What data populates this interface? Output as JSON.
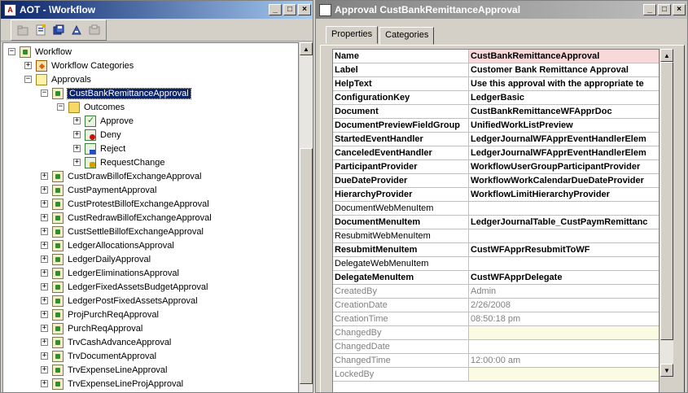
{
  "left_window": {
    "title": "AOT - \\Workflow",
    "tree": {
      "root": "Workflow",
      "categories": "Workflow Categories",
      "approvals": "Approvals",
      "selected": "CustBankRemittanceApproval",
      "outcomes": "Outcomes",
      "outcome_items": [
        "Approve",
        "Deny",
        "Reject",
        "RequestChange"
      ],
      "items": [
        "CustDrawBillofExchangeApproval",
        "CustPaymentApproval",
        "CustProtestBillofExchangeApproval",
        "CustRedrawBillofExchangeApproval",
        "CustSettleBillofExchangeApproval",
        "LedgerAllocationsApproval",
        "LedgerDailyApproval",
        "LedgerEliminationsApproval",
        "LedgerFixedAssetsBudgetApproval",
        "LedgerPostFixedAssetsApproval",
        "ProjPurchReqApproval",
        "PurchReqApproval",
        "TrvCashAdvanceApproval",
        "TrvDocumentApproval",
        "TrvExpenseLineApproval",
        "TrvExpenseLineProjApproval"
      ]
    }
  },
  "right_window": {
    "title": "Approval CustBankRemittanceApproval",
    "tabs": [
      "Properties",
      "Categories"
    ],
    "properties": [
      {
        "name": "Name",
        "value": "CustBankRemittanceApproval",
        "style": "bold",
        "highlight": "pink"
      },
      {
        "name": "Label",
        "value": "Customer Bank Remittance Approval",
        "style": "bold"
      },
      {
        "name": "HelpText",
        "value": "Use this approval with the appropriate te",
        "style": "bold"
      },
      {
        "name": "ConfigurationKey",
        "value": "LedgerBasic",
        "style": "bold"
      },
      {
        "name": "Document",
        "value": "CustBankRemittanceWFApprDoc",
        "style": "bold"
      },
      {
        "name": "DocumentPreviewFieldGroup",
        "value": "UnifiedWorkListPreview",
        "style": "bold"
      },
      {
        "name": "StartedEventHandler",
        "value": "LedgerJournalWFApprEventHandlerElem",
        "style": "bold"
      },
      {
        "name": "CanceledEventHandler",
        "value": "LedgerJournalWFApprEventHandlerElem",
        "style": "bold"
      },
      {
        "name": "ParticipantProvider",
        "value": "WorkflowUserGroupParticipantProvider",
        "style": "bold"
      },
      {
        "name": "DueDateProvider",
        "value": "WorkflowWorkCalendarDueDateProvider",
        "style": "bold"
      },
      {
        "name": "HierarchyProvider",
        "value": "WorkflowLimitHierarchyProvider",
        "style": "bold"
      },
      {
        "name": "DocumentWebMenuItem",
        "value": "",
        "style": "normal"
      },
      {
        "name": "DocumentMenuItem",
        "value": "LedgerJournalTable_CustPaymRemittanc",
        "style": "bold"
      },
      {
        "name": "ResubmitWebMenuItem",
        "value": "",
        "style": "normal"
      },
      {
        "name": "ResubmitMenuItem",
        "value": "CustWFApprResubmitToWF",
        "style": "bold"
      },
      {
        "name": "DelegateWebMenuItem",
        "value": "",
        "style": "normal"
      },
      {
        "name": "DelegateMenuItem",
        "value": "CustWFApprDelegate",
        "style": "bold"
      },
      {
        "name": "CreatedBy",
        "value": "Admin",
        "style": "readonly"
      },
      {
        "name": "CreationDate",
        "value": "2/26/2008",
        "style": "readonly"
      },
      {
        "name": "CreationTime",
        "value": "08:50:18 pm",
        "style": "readonly"
      },
      {
        "name": "ChangedBy",
        "value": "",
        "style": "readonly",
        "highlight": "yellow"
      },
      {
        "name": "ChangedDate",
        "value": "",
        "style": "readonly"
      },
      {
        "name": "ChangedTime",
        "value": "12:00:00 am",
        "style": "readonly"
      },
      {
        "name": "LockedBy",
        "value": "",
        "style": "readonly",
        "highlight": "yellow"
      }
    ]
  },
  "colors": {
    "active_title": "#0a246a",
    "inactive_title": "#808080",
    "selection": "#0a246a",
    "name_highlight": "#f8d8d8",
    "field_highlight": "#fbfbe3"
  }
}
